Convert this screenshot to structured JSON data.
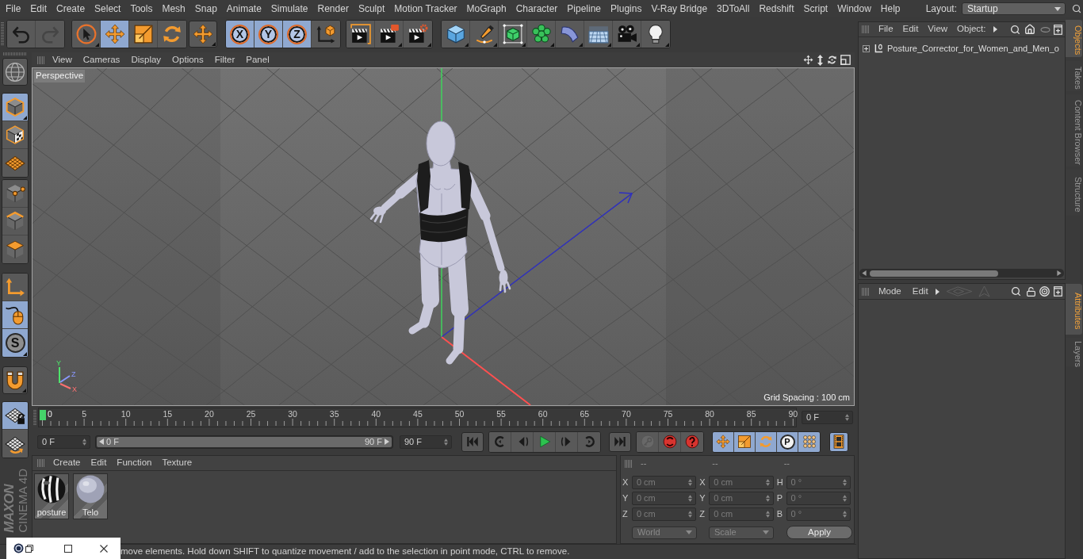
{
  "menu_bar": {
    "items": [
      "File",
      "Edit",
      "Create",
      "Select",
      "Tools",
      "Mesh",
      "Snap",
      "Animate",
      "Simulate",
      "Render",
      "Sculpt",
      "Motion Tracker",
      "MoGraph",
      "Character",
      "Pipeline",
      "Plugins",
      "V-Ray Bridge",
      "3DToAll",
      "Redshift",
      "Script",
      "Window",
      "Help"
    ],
    "layout_label": "Layout:",
    "layout_value": "Startup"
  },
  "toolbar": {
    "groups": [
      [
        {
          "kind": "undo",
          "selected": false,
          "disabled": false,
          "submenu": false
        },
        {
          "kind": "redo",
          "selected": false,
          "disabled": true,
          "submenu": false
        }
      ],
      [
        {
          "kind": "select",
          "selected": false,
          "disabled": false,
          "submenu": true
        },
        {
          "kind": "move",
          "selected": true,
          "disabled": false,
          "submenu": false
        },
        {
          "kind": "scale",
          "selected": false,
          "disabled": false,
          "submenu": false
        },
        {
          "kind": "rotate",
          "selected": false,
          "disabled": false,
          "submenu": false
        }
      ],
      [
        {
          "kind": "move",
          "selected": false,
          "disabled": false,
          "submenu": true
        }
      ],
      [
        {
          "kind": "lock",
          "label": "X",
          "selected": true,
          "disabled": false,
          "submenu": false
        },
        {
          "kind": "lock",
          "label": "Y",
          "selected": true,
          "disabled": false,
          "submenu": false
        },
        {
          "kind": "lock",
          "label": "Z",
          "selected": true,
          "disabled": false,
          "submenu": false
        },
        {
          "kind": "coords",
          "selected": false,
          "disabled": false,
          "submenu": false
        }
      ],
      [
        {
          "kind": "renderview",
          "selected": false,
          "disabled": false,
          "submenu": false
        },
        {
          "kind": "renderpicture",
          "selected": false,
          "disabled": false,
          "submenu": true
        },
        {
          "kind": "rendersettings",
          "selected": false,
          "disabled": false,
          "submenu": true
        }
      ],
      [
        {
          "kind": "cube",
          "selected": false,
          "disabled": false,
          "submenu": true
        },
        {
          "kind": "pen",
          "selected": false,
          "disabled": false,
          "submenu": true
        },
        {
          "kind": "subdivide",
          "selected": false,
          "disabled": false,
          "submenu": true
        },
        {
          "kind": "cloner",
          "selected": false,
          "disabled": false,
          "submenu": true
        },
        {
          "kind": "deformer",
          "selected": false,
          "disabled": false,
          "submenu": true
        },
        {
          "kind": "floor",
          "selected": false,
          "disabled": false,
          "submenu": true
        },
        {
          "kind": "camera",
          "selected": false,
          "disabled": false,
          "submenu": true
        },
        {
          "kind": "light",
          "selected": false,
          "disabled": false,
          "submenu": true
        }
      ]
    ]
  },
  "side_toolbar": {
    "groups": [
      [
        {
          "kind": "editable",
          "selected": false,
          "submenu": false
        }
      ],
      [
        {
          "kind": "model",
          "selected": true,
          "submenu": true
        },
        {
          "kind": "texture",
          "selected": false,
          "submenu": false
        },
        {
          "kind": "workplane",
          "selected": false,
          "submenu": false
        }
      ],
      [
        {
          "kind": "points",
          "selected": false,
          "submenu": false
        },
        {
          "kind": "edges",
          "selected": false,
          "submenu": false
        },
        {
          "kind": "polygons",
          "selected": false,
          "submenu": false
        }
      ],
      [
        {
          "kind": "axismode",
          "selected": false,
          "submenu": false
        },
        {
          "kind": "tweak",
          "selected": true,
          "submenu": false
        },
        {
          "kind": "solo",
          "label": "S",
          "selected": true,
          "submenu": true
        }
      ],
      [
        {
          "kind": "snap",
          "selected": false,
          "submenu": true
        }
      ],
      [
        {
          "kind": "wplock",
          "selected": true,
          "submenu": false
        },
        {
          "kind": "wprotate",
          "selected": false,
          "submenu": false
        }
      ]
    ]
  },
  "logo": {
    "brand": "MAXON",
    "product": "CINEMA 4D"
  },
  "viewport": {
    "menu": [
      "View",
      "Cameras",
      "Display",
      "Options",
      "Filter",
      "Panel"
    ],
    "camera": "Perspective",
    "grid_spacing": "Grid Spacing : 100 cm",
    "gizmo_labels": [
      "Y",
      "Z",
      "X"
    ]
  },
  "timeline": {
    "ticks": [
      "0",
      "5",
      "10",
      "15",
      "20",
      "25",
      "30",
      "35",
      "40",
      "45",
      "50",
      "55",
      "60",
      "65",
      "70",
      "75",
      "80",
      "85",
      "90"
    ],
    "current_frame": "0 F"
  },
  "transport": {
    "start_field": "0 F",
    "range_start": "0 F",
    "range_end": "90 F",
    "end_field": "90 F",
    "groups": [
      [
        {
          "kind": "start",
          "selected": false,
          "disabled": false
        }
      ],
      [
        {
          "kind": "prevkey",
          "selected": false,
          "disabled": false
        },
        {
          "kind": "prevframe",
          "selected": false,
          "disabled": false
        },
        {
          "kind": "play",
          "selected": false,
          "disabled": false
        },
        {
          "kind": "nextframe",
          "selected": false,
          "disabled": false
        },
        {
          "kind": "nextkey",
          "selected": false,
          "disabled": false
        }
      ],
      [
        {
          "kind": "end",
          "selected": false,
          "disabled": false
        }
      ],
      [
        {
          "kind": "record",
          "selected": false,
          "disabled": true
        },
        {
          "kind": "autokey",
          "selected": false,
          "disabled": false
        },
        {
          "kind": "keyselect",
          "selected": false,
          "disabled": false
        }
      ],
      [
        {
          "kind": "keymove",
          "selected": true,
          "disabled": false
        },
        {
          "kind": "keyscale",
          "selected": true,
          "disabled": false
        },
        {
          "kind": "keyrotate",
          "selected": true,
          "disabled": false
        },
        {
          "kind": "keyparam",
          "label": "P",
          "selected": true,
          "disabled": false
        },
        {
          "kind": "keypla",
          "selected": true,
          "disabled": false
        }
      ],
      [
        {
          "kind": "timeline",
          "selected": true,
          "disabled": false
        }
      ]
    ]
  },
  "materials": {
    "menu": [
      "Create",
      "Edit",
      "Function",
      "Texture"
    ],
    "items": [
      {
        "name": "posture",
        "kind": "striped"
      },
      {
        "name": "Telo",
        "kind": "plain"
      }
    ]
  },
  "coordinates": {
    "headers": [
      "--",
      "--",
      "--"
    ],
    "rows": [
      [
        {
          "axis": "X",
          "value": "0 cm"
        },
        {
          "axis": "X",
          "value": "0 cm"
        },
        {
          "axis": "H",
          "value": "0 °"
        }
      ],
      [
        {
          "axis": "Y",
          "value": "0 cm"
        },
        {
          "axis": "Y",
          "value": "0 cm"
        },
        {
          "axis": "P",
          "value": "0 °"
        }
      ],
      [
        {
          "axis": "Z",
          "value": "0 cm"
        },
        {
          "axis": "Z",
          "value": "0 cm"
        },
        {
          "axis": "B",
          "value": "0 °"
        }
      ]
    ],
    "dropdowns": [
      "World",
      "Scale"
    ],
    "apply": "Apply"
  },
  "status_bar": {
    "text": "move elements. Hold down SHIFT to quantize movement / add to the selection in point mode, CTRL to remove."
  },
  "objects_manager": {
    "menu": [
      "File",
      "Edit",
      "View",
      "Object:"
    ],
    "items": [
      {
        "name": "Posture_Corrector_for_Women_and_Men_o",
        "expanded": false
      }
    ]
  },
  "attributes_manager": {
    "menu": [
      "Mode",
      "Edit"
    ]
  },
  "side_tabs": {
    "upper": [
      {
        "label": "Objects",
        "selected": true
      },
      {
        "label": "Takes",
        "selected": false
      },
      {
        "label": "Content Browser",
        "selected": false
      },
      {
        "label": "Structure",
        "selected": false
      }
    ],
    "lower": [
      {
        "label": "Attributes",
        "selected": true
      },
      {
        "label": "Layers",
        "selected": false
      }
    ]
  }
}
